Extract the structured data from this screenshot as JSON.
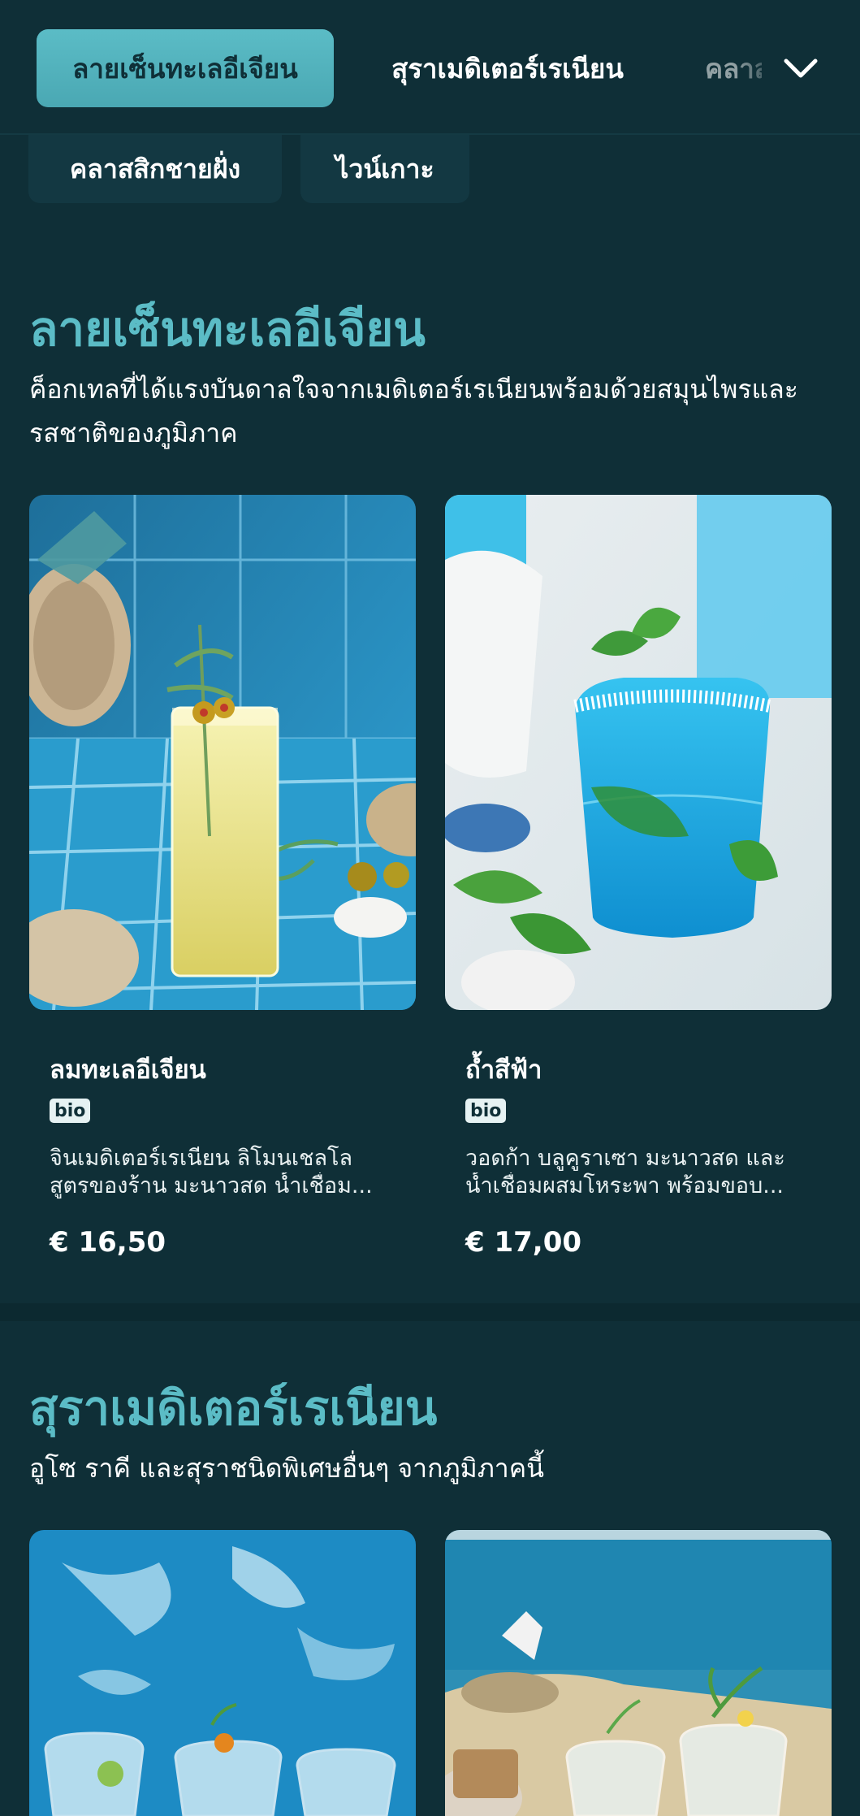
{
  "nav": {
    "tabs": [
      {
        "label": "ลายเซ็นทะเลอีเจียน",
        "active": true
      },
      {
        "label": "สุราเมดิเตอร์เรเนียน",
        "active": false
      },
      {
        "label": "คลาสสิกชายฝั่ง",
        "active": false
      }
    ],
    "more_icon": "chevron-down-icon",
    "chips": [
      "คลาสสิกชายฝั่ง",
      "ไวน์เกาะ"
    ]
  },
  "sections": [
    {
      "title": "ลายเซ็นทะเลอีเจียน",
      "description": "ค็อกเทลที่ได้แรงบันดาลใจจากเมดิเตอร์เรเนียนพร้อมด้วยสมุนไพรและรสชาติของภูมิภาค",
      "items": [
        {
          "name": "ลมทะเลอีเจียน",
          "badge": "bio",
          "desc_line1": "จินเมดิเตอร์เรเนียน ลิโมนเชลโล",
          "desc_line2": "สูตรของร้าน มะนาวสด น้ำเชื่อม...",
          "price": "€ 16,50"
        },
        {
          "name": "ถ้ำสีฟ้า",
          "badge": "bio",
          "desc_line1": "วอดก้า บลูคูราเซา มะนาวสด และ",
          "desc_line2": "น้ำเชื่อมผสมโหระพา พร้อมขอบ...",
          "price": "€ 17,00"
        }
      ]
    },
    {
      "title": "สุราเมดิเตอร์เรเนียน",
      "description": "อูโซ ราคี และสุราชนิดพิเศษอื่นๆ จากภูมิภาคนี้",
      "items": []
    }
  ],
  "colors": {
    "background": "#0f2f37",
    "accent": "#5bbcc6",
    "chip": "#133842"
  }
}
